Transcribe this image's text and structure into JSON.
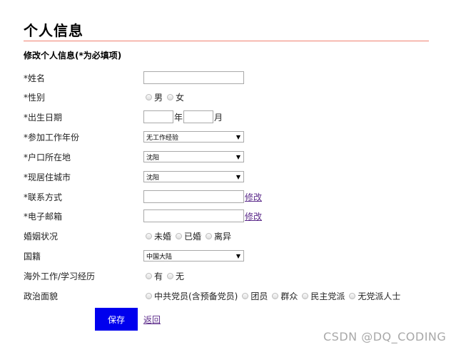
{
  "page": {
    "title": "个人信息",
    "section_title": "修改个人信息(*为必填项)"
  },
  "fields": {
    "name": {
      "label": "*姓名",
      "value": ""
    },
    "gender": {
      "label": "*性别",
      "options": [
        "男",
        "女"
      ]
    },
    "birth": {
      "label": "*出生日期",
      "year_value": "",
      "year_unit": "年",
      "month_value": "",
      "month_unit": "月"
    },
    "work_year": {
      "label": "*参加工作年份",
      "selected": "无工作经验"
    },
    "hukou": {
      "label": "*户口所在地",
      "selected": "沈阳"
    },
    "city": {
      "label": "*现居住城市",
      "selected": "沈阳"
    },
    "contact": {
      "label": "*联系方式",
      "value": "",
      "link": "修改"
    },
    "email": {
      "label": "*电子邮箱",
      "value": "",
      "link": "修改"
    },
    "marital": {
      "label": "婚姻状况",
      "options": [
        "未婚",
        "已婚",
        "离异"
      ]
    },
    "nationality": {
      "label": "国籍",
      "selected": "中国大陆"
    },
    "overseas": {
      "label": "海外工作/学习经历",
      "options": [
        "有",
        "无"
      ]
    },
    "political": {
      "label": "政治面貌",
      "options": [
        "中共党员(含预备党员)",
        "团员",
        "群众",
        "民主党派",
        "无党派人士"
      ]
    }
  },
  "actions": {
    "save_label": "保存",
    "back_label": "返回"
  },
  "watermark": "CSDN @DQ_CODING",
  "icons": {
    "select_arrow": "dropdown-arrow-icon",
    "radio": "radio-unchecked-icon"
  },
  "colors": {
    "title_rule": "#f08070",
    "save_button": "#0000ee",
    "link": "#5b2a8a"
  }
}
